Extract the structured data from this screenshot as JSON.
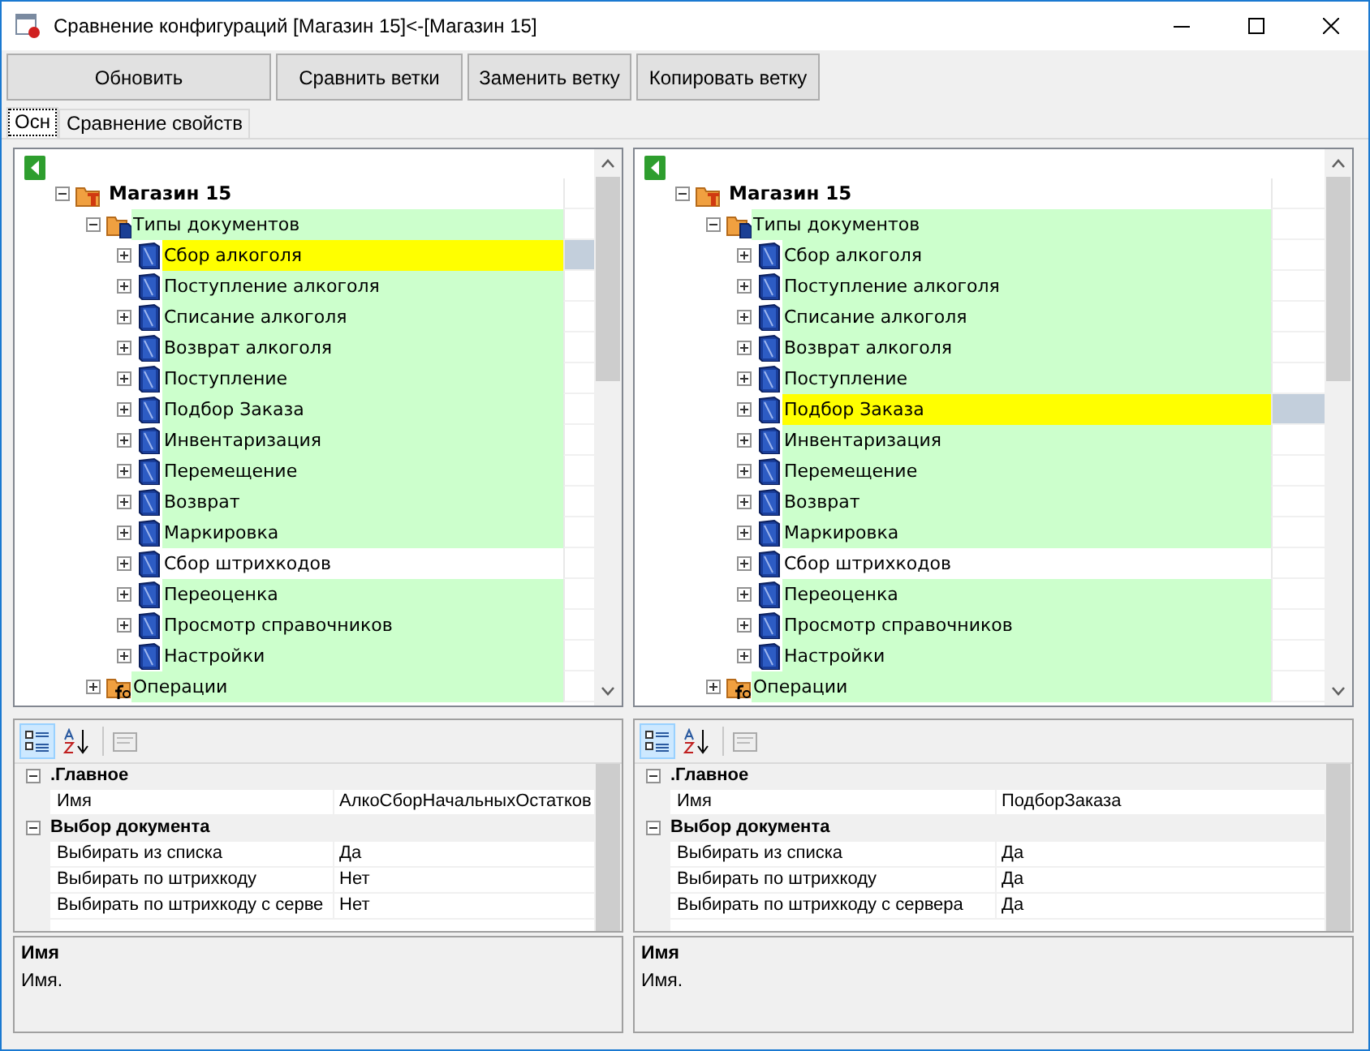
{
  "window": {
    "title": "Сравнение конфигураций [Магазин 15]<-[Магазин 15]"
  },
  "toolbar": {
    "buttons": [
      "Обновить",
      "Сравнить ветки",
      "Заменить ветку",
      "Копировать ветку"
    ]
  },
  "tabs": [
    {
      "label": "Осн",
      "selected": true
    },
    {
      "label": "Сравнение свойств",
      "selected": false
    }
  ],
  "panes": [
    {
      "tree": [
        {
          "label": "Магазин 15",
          "kind": "store",
          "expanded": true,
          "match": false,
          "selected": false,
          "children": [
            {
              "label": "Типы документов",
              "kind": "group",
              "expanded": true,
              "match": true,
              "selected": false,
              "children": [
                {
                  "label": "Сбор алкоголя",
                  "kind": "doc",
                  "expanded": false,
                  "match": true,
                  "selected": true
                },
                {
                  "label": "Поступление алкоголя",
                  "kind": "doc",
                  "expanded": false,
                  "match": true,
                  "selected": false
                },
                {
                  "label": "Списание алкоголя",
                  "kind": "doc",
                  "expanded": false,
                  "match": true,
                  "selected": false
                },
                {
                  "label": "Возврат алкоголя",
                  "kind": "doc",
                  "expanded": false,
                  "match": true,
                  "selected": false
                },
                {
                  "label": "Поступление",
                  "kind": "doc",
                  "expanded": false,
                  "match": true,
                  "selected": false
                },
                {
                  "label": "Подбор Заказа",
                  "kind": "doc",
                  "expanded": false,
                  "match": true,
                  "selected": false
                },
                {
                  "label": "Инвентаризация",
                  "kind": "doc",
                  "expanded": false,
                  "match": true,
                  "selected": false
                },
                {
                  "label": "Перемещение",
                  "kind": "doc",
                  "expanded": false,
                  "match": true,
                  "selected": false
                },
                {
                  "label": "Возврат",
                  "kind": "doc",
                  "expanded": false,
                  "match": true,
                  "selected": false
                },
                {
                  "label": "Маркировка",
                  "kind": "doc",
                  "expanded": false,
                  "match": true,
                  "selected": false
                },
                {
                  "label": "Сбор штрихкодов",
                  "kind": "doc",
                  "expanded": false,
                  "match": false,
                  "selected": false
                },
                {
                  "label": "Переоценка",
                  "kind": "doc",
                  "expanded": false,
                  "match": true,
                  "selected": false
                },
                {
                  "label": "Просмотр справочников",
                  "kind": "doc",
                  "expanded": false,
                  "match": true,
                  "selected": false
                },
                {
                  "label": "Настройки",
                  "kind": "doc",
                  "expanded": false,
                  "match": true,
                  "selected": false
                }
              ]
            },
            {
              "label": "Операции",
              "kind": "operations",
              "expanded": false,
              "match": true,
              "selected": false
            }
          ]
        }
      ],
      "view_modes": [
        {
          "kind": "categorized",
          "selected": true
        },
        {
          "kind": "alphabetical",
          "selected": false
        }
      ],
      "properties": [
        {
          "label": ".Главное",
          "expanded": true,
          "rows": [
            {
              "name": "Имя",
              "value": "АлкоСборНачальныхОстатков"
            }
          ]
        },
        {
          "label": "Выбор документа",
          "expanded": true,
          "rows": [
            {
              "name": "Выбирать из списка",
              "value": "Да"
            },
            {
              "name": "Выбирать по штрихкоду",
              "value": "Нет"
            },
            {
              "name": "Выбирать по штрихкоду с серве",
              "value": "Нет"
            }
          ]
        }
      ],
      "description": {
        "title": "Имя",
        "text": "Имя."
      }
    },
    {
      "tree": [
        {
          "label": "Магазин 15",
          "kind": "store",
          "expanded": true,
          "match": false,
          "selected": false,
          "children": [
            {
              "label": "Типы документов",
              "kind": "group",
              "expanded": true,
              "match": true,
              "selected": false,
              "children": [
                {
                  "label": "Сбор алкоголя",
                  "kind": "doc",
                  "expanded": false,
                  "match": true,
                  "selected": false
                },
                {
                  "label": "Поступление алкоголя",
                  "kind": "doc",
                  "expanded": false,
                  "match": true,
                  "selected": false
                },
                {
                  "label": "Списание алкоголя",
                  "kind": "doc",
                  "expanded": false,
                  "match": true,
                  "selected": false
                },
                {
                  "label": "Возврат алкоголя",
                  "kind": "doc",
                  "expanded": false,
                  "match": true,
                  "selected": false
                },
                {
                  "label": "Поступление",
                  "kind": "doc",
                  "expanded": false,
                  "match": true,
                  "selected": false
                },
                {
                  "label": "Подбор Заказа",
                  "kind": "doc",
                  "expanded": false,
                  "match": true,
                  "selected": true
                },
                {
                  "label": "Инвентаризация",
                  "kind": "doc",
                  "expanded": false,
                  "match": true,
                  "selected": false
                },
                {
                  "label": "Перемещение",
                  "kind": "doc",
                  "expanded": false,
                  "match": true,
                  "selected": false
                },
                {
                  "label": "Возврат",
                  "kind": "doc",
                  "expanded": false,
                  "match": true,
                  "selected": false
                },
                {
                  "label": "Маркировка",
                  "kind": "doc",
                  "expanded": false,
                  "match": true,
                  "selected": false
                },
                {
                  "label": "Сбор штрихкодов",
                  "kind": "doc",
                  "expanded": false,
                  "match": false,
                  "selected": false
                },
                {
                  "label": "Переоценка",
                  "kind": "doc",
                  "expanded": false,
                  "match": true,
                  "selected": false
                },
                {
                  "label": "Просмотр справочников",
                  "kind": "doc",
                  "expanded": false,
                  "match": true,
                  "selected": false
                },
                {
                  "label": "Настройки",
                  "kind": "doc",
                  "expanded": false,
                  "match": true,
                  "selected": false
                }
              ]
            },
            {
              "label": "Операции",
              "kind": "operations",
              "expanded": false,
              "match": true,
              "selected": false
            }
          ]
        }
      ],
      "view_modes": [
        {
          "kind": "categorized",
          "selected": true
        },
        {
          "kind": "alphabetical",
          "selected": false
        }
      ],
      "properties": [
        {
          "label": ".Главное",
          "expanded": true,
          "rows": [
            {
              "name": "Имя",
              "value": "ПодборЗаказа"
            }
          ]
        },
        {
          "label": "Выбор документа",
          "expanded": true,
          "rows": [
            {
              "name": "Выбирать из списка",
              "value": "Да"
            },
            {
              "name": "Выбирать по штрихкоду",
              "value": "Да"
            },
            {
              "name": "Выбирать по штрихкоду с сервера",
              "value": "Да"
            }
          ]
        }
      ],
      "description": {
        "title": "Имя",
        "text": "Имя."
      }
    }
  ]
}
